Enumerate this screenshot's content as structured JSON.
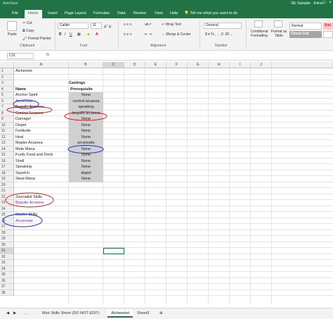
{
  "window": {
    "title": "SE Sample - Excel",
    "qat_label": "AutoSave"
  },
  "ribbon_tabs": [
    "File",
    "Home",
    "Insert",
    "Page Layout",
    "Formulas",
    "Data",
    "Review",
    "View",
    "Help"
  ],
  "tell_me": "Tell me what you want to do",
  "ribbon": {
    "paste": "Paste",
    "cut": "Cut",
    "copy": "Copy",
    "format_painter": "Format Painter",
    "clipboard": "Clipboard",
    "font_name": "Calibri",
    "font_size": "11",
    "font": "Font",
    "wrap_text": "Wrap Text",
    "merge_center": "Merge & Center",
    "alignment": "Alignment",
    "number_format": "General",
    "number": "Number",
    "conditional_formatting": "Conditional Formatting",
    "format_as_table": "Format as Table",
    "style_normal": "Normal",
    "style_bad": "Bad",
    "style_check_cell": "Check Cell"
  },
  "formula_bar": {
    "name_box": "C31",
    "fx": "fx"
  },
  "columns": [
    "A",
    "B",
    "C",
    "D",
    "E",
    "F",
    "G",
    "H",
    "I",
    "J"
  ],
  "rows": [
    "1",
    "2",
    "3",
    "4",
    "5",
    "6",
    "7",
    "8",
    "9",
    "10",
    "11",
    "12",
    "13",
    "14",
    "15",
    "16",
    "17",
    "18",
    "19",
    "20",
    "21",
    "22",
    "23",
    "24",
    "25",
    "26",
    "27",
    "28",
    "29",
    "30",
    "31",
    "32",
    "33",
    "34",
    "35",
    "36",
    "37",
    "38"
  ],
  "cells": {
    "a1": "Alchemist",
    "b3": "Castings",
    "a4": "Name",
    "b4": "Prerequisite",
    "castings": [
      {
        "name": "Anchor Spirit",
        "pre": "None"
      },
      {
        "name": "Arcaneate",
        "pre": "control arcanea"
      },
      {
        "name": "Beguile Arcanea",
        "pre": "speaking"
      },
      {
        "name": "Control Arcanea",
        "pre": "beguile arcanea"
      },
      {
        "name": "Damage!",
        "pre": "None"
      },
      {
        "name": "Dispel",
        "pre": "None"
      },
      {
        "name": "Fortitude",
        "pre": "None"
      },
      {
        "name": "Heal",
        "pre": "None"
      },
      {
        "name": "Master Arcanea",
        "pre": "arcaneate"
      },
      {
        "name": "Mete Mana",
        "pre": "None"
      },
      {
        "name": "Purify Food and Drink",
        "pre": "None"
      },
      {
        "name": "Shell",
        "pre": "None"
      },
      {
        "name": "Speaking",
        "pre": "None"
      },
      {
        "name": "Squelch",
        "pre": "dispel"
      },
      {
        "name": "Steal Mana",
        "pre": "None"
      }
    ],
    "a21": "Journalist Skills",
    "a22": "Beguile Arcanea",
    "a24": "Master Skills",
    "a25": "Arcaneate"
  },
  "sheet_tabs": [
    "Mstr Skills Sheet (DO NOT EDIT)",
    "Alchemist",
    "Sheet3"
  ],
  "colors": {
    "excel_green": "#217346",
    "annotation_red": "#d42020",
    "annotation_blue": "#2233cc",
    "purple_text": "#7030a0"
  }
}
